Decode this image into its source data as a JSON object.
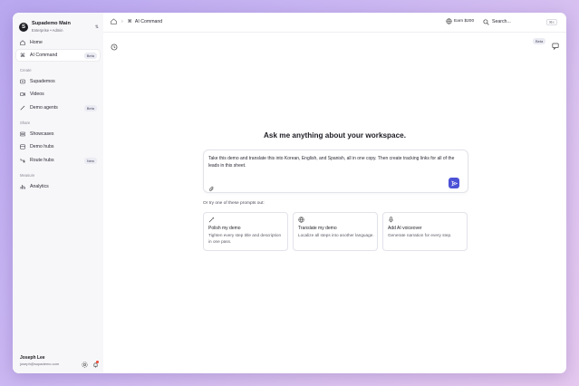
{
  "workspace": {
    "logo_letter": "S",
    "name": "Supademo Main",
    "subtitle": "Enterprise • Admin"
  },
  "sidebar": {
    "home": "Home",
    "ai_command": {
      "label": "AI Command",
      "badge": "Beta"
    },
    "section_create": "Create",
    "supademos": "Supademos",
    "videos": "Videos",
    "demo_agents": {
      "label": "Demo agents",
      "badge": "Beta"
    },
    "section_share": "Share",
    "showcases": "Showcases",
    "demo_hubs": "Demo hubs",
    "route_hubs": {
      "label": "Route hubs",
      "badge": "New"
    },
    "section_measure": "Measure",
    "analytics": "Analytics"
  },
  "user": {
    "name": "Joseph Lee",
    "email": "joseph@supademo.com"
  },
  "topbar": {
    "breadcrumb_current": "AI Command",
    "earn": "Earn $200",
    "search_placeholder": "Search...",
    "search_shortcut": "⌘K"
  },
  "main": {
    "beta_badge": "Beta",
    "heading": "Ask me anything about your workspace.",
    "prompt_text": "Take this demo and translate this into Korean, English, and Spanish, all in one copy. Then create tracking links for all of the leads in this sheet.",
    "hint": "Or try one of these prompts out:",
    "suggestions": [
      {
        "title": "Polish my demo",
        "desc": "Tighten every step title and description in one pass."
      },
      {
        "title": "Translate my demo",
        "desc": "Localize all steps into another language."
      },
      {
        "title": "Add AI voiceover",
        "desc": "Generate narration for every step."
      }
    ]
  },
  "colors": {
    "accent": "#4c52d6",
    "notification": "#ef4a3a"
  }
}
